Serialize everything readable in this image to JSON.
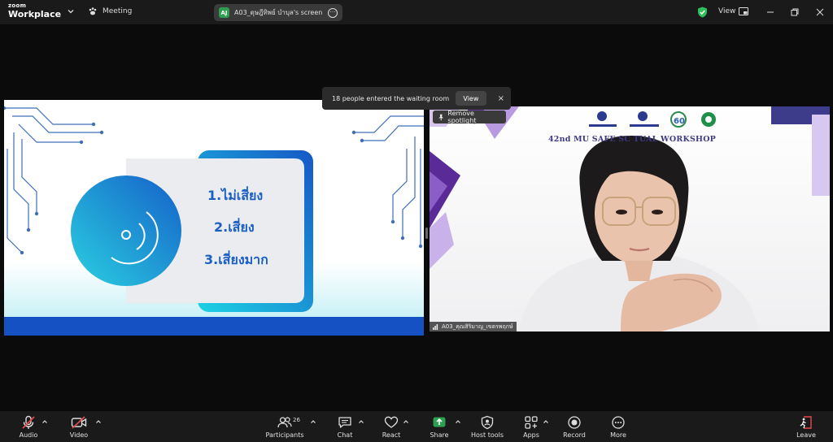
{
  "app": {
    "brand_top": "zoom",
    "brand_bottom": "Workplace",
    "meeting_label": "Meeting",
    "share_avatar": "AJ",
    "share_title": "A03_ดุษฎีทิพย์ บำบุล's screen",
    "view_label": "View"
  },
  "toast": {
    "message": "18 people entered the waiting room",
    "view_button": "View",
    "close_glyph": "×"
  },
  "slide": {
    "items": [
      "1.ไม่เสี่ยง",
      "2.เสี่ยง",
      "3.เสี่ยงมาก"
    ]
  },
  "video": {
    "spotlight_label": "Remove spotlight",
    "workshop_title": "42nd MU SAFE SC   TUAL WORKSHOP",
    "name_tag": "A03_คุณสิริมาญ_เขตรพฤกษ์"
  },
  "toolbar": {
    "audio": "Audio",
    "video": "Video",
    "participants": "Participants",
    "participants_count": "26",
    "chat": "Chat",
    "react": "React",
    "share": "Share",
    "host_tools": "Host tools",
    "apps": "Apps",
    "record": "Record",
    "more": "More",
    "leave": "Leave"
  },
  "colors": {
    "share_green": "#2e9e52",
    "slide_blue": "#1b5fc4",
    "leave_red": "#e5484d",
    "workshop_purple": "#6b3fa0"
  }
}
